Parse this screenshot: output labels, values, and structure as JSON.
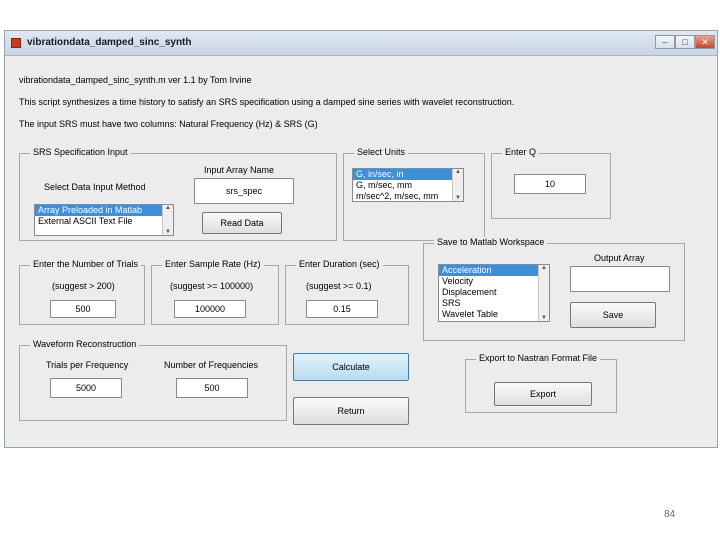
{
  "window": {
    "title": "vibrationdata_damped_sinc_synth",
    "controls": {
      "minimize": "–",
      "maximize": "□",
      "close": "✕"
    }
  },
  "header": {
    "line1": "vibrationdata_damped_sinc_synth.m ver 1.1 by Tom Irvine",
    "line2": "This script synthesizes a time history to satisfy an SRS specification using a damped sine series with wavelet reconstruction.",
    "line3": "The input SRS must have two columns: Natural Frequency (Hz) & SRS (G)"
  },
  "srs_spec": {
    "title": "SRS Specification Input",
    "input_array_label": "Input Array Name",
    "input_array_value": "srs_spec",
    "method_label": "Select Data Input Method",
    "methods": [
      "Array Preloaded in Matlab",
      "External ASCII Text File"
    ],
    "read_button": "Read Data"
  },
  "units": {
    "title": "Select Units",
    "options": [
      "G, in/sec, in",
      "G, m/sec, mm",
      "m/sec^2, m/sec, mm"
    ]
  },
  "q": {
    "title": "Enter Q",
    "value": "10"
  },
  "trials": {
    "title": "Enter the Number of Trials",
    "hint": "(suggest > 200)",
    "value": "500"
  },
  "sample_rate": {
    "title": "Enter Sample Rate (Hz)",
    "hint": "(suggest >= 100000)",
    "value": "100000"
  },
  "duration": {
    "title": "Enter Duration (sec)",
    "hint": "(suggest >= 0.1)",
    "value": "0.15"
  },
  "workspace": {
    "title": "Save to Matlab Workspace",
    "options": [
      "Acceleration",
      "Velocity",
      "Displacement",
      "SRS",
      "Wavelet Table"
    ],
    "output_label": "Output Array",
    "output_value": "",
    "save_button": "Save"
  },
  "waveform": {
    "title": "Waveform Reconstruction",
    "trials_label": "Trials per Frequency",
    "trials_value": "5000",
    "freq_label": "Number of Frequencies",
    "freq_value": "500"
  },
  "buttons": {
    "calculate": "Calculate",
    "return": "Return"
  },
  "export": {
    "title": "Export to Nastran Format File",
    "button": "Export"
  },
  "slide_number": "84"
}
